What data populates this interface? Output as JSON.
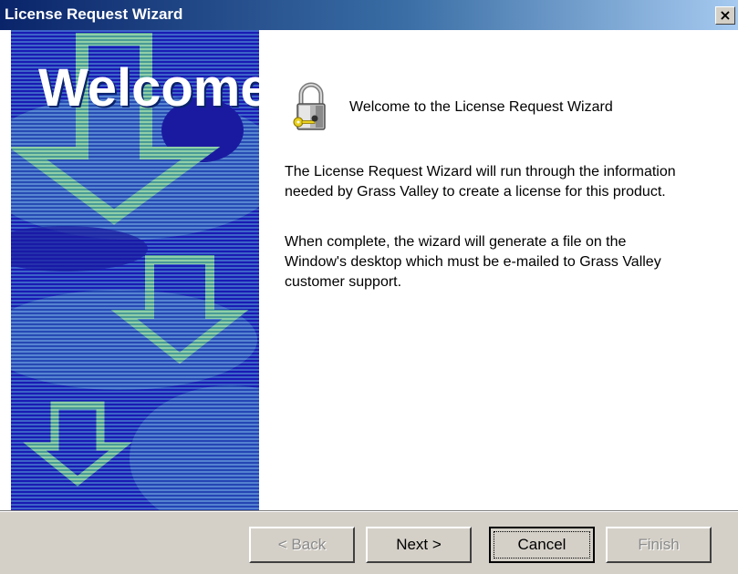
{
  "window": {
    "title": "License Request Wizard",
    "close_label": "×"
  },
  "side_panel": {
    "heading": "Welcome"
  },
  "content": {
    "title": "Welcome to the License Request Wizard",
    "paragraph1": "The License Request Wizard will run through the information\nneeded by Grass Valley to create a license for this product.",
    "paragraph2": "When complete, the wizard will generate a file on the\nWindow's desktop which must be e-mailed to Grass Valley\ncustomer support."
  },
  "buttons": {
    "back": "< Back",
    "next": "Next >",
    "cancel": "Cancel",
    "finish": "Finish"
  },
  "colors": {
    "panel_blue": "#1e1ea8",
    "arrow": "#6bb59a",
    "titlebar": "#0a246a"
  }
}
